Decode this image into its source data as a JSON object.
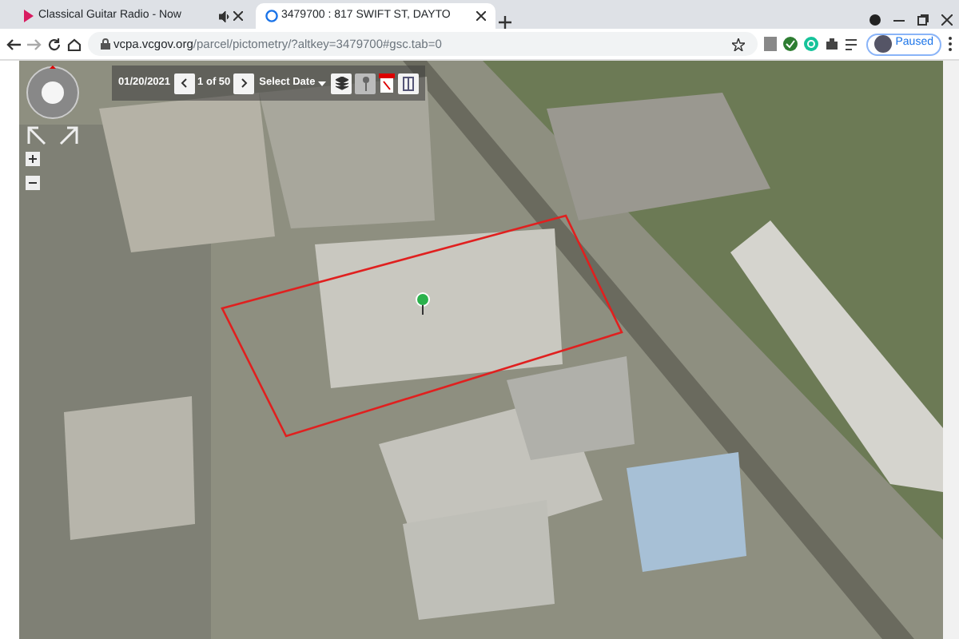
{
  "browser": {
    "tabs": [
      {
        "title": "Classical Guitar Radio - Now",
        "selected": false,
        "audio": true
      },
      {
        "title": "3479700 : 817 SWIFT ST, DAYTO",
        "selected": true,
        "audio": false
      }
    ],
    "address": {
      "domain": "vcpa.vcgov.org",
      "path": "/parcel/pictometry/?altkey=3479700#gsc.tab=0"
    },
    "profile": {
      "label": "Paused"
    }
  },
  "viewer": {
    "date": "01/20/2021",
    "page": "1 of 50",
    "select_date": "Select Date"
  }
}
